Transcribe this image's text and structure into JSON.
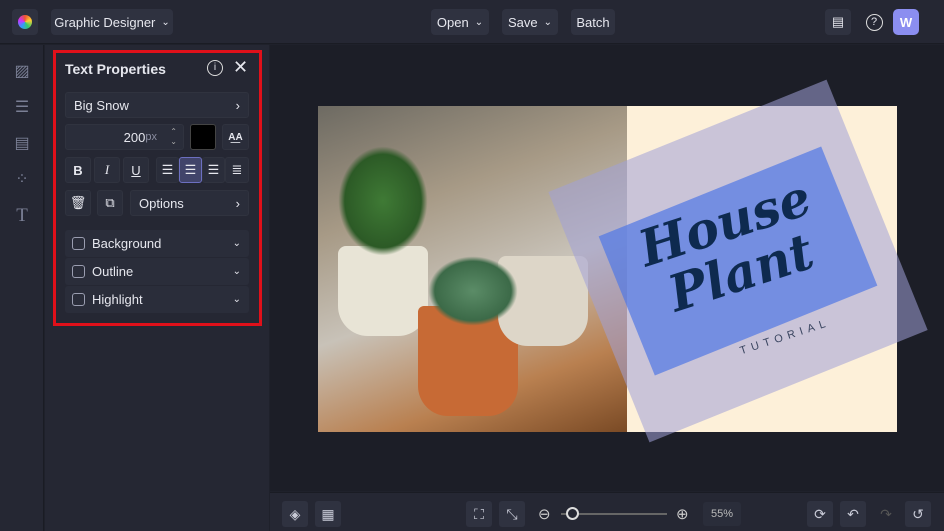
{
  "topbar": {
    "app_mode": "Graphic Designer",
    "open": "Open",
    "save": "Save",
    "batch": "Batch",
    "avatar": "W"
  },
  "panel": {
    "title": "Text Properties",
    "font": "Big Snow",
    "size_value": "200",
    "size_unit": "px",
    "options": "Options",
    "sections": [
      {
        "label": "Background"
      },
      {
        "label": "Outline"
      },
      {
        "label": "Highlight"
      }
    ],
    "bold": "B",
    "italic": "I",
    "underline": "U",
    "text_color": "#000000"
  },
  "canvas": {
    "headline_1": "House",
    "headline_2": "Plant",
    "subtitle": "TUTORIAL"
  },
  "bottombar": {
    "zoom": "55%",
    "zoom_fraction": 0.05
  }
}
